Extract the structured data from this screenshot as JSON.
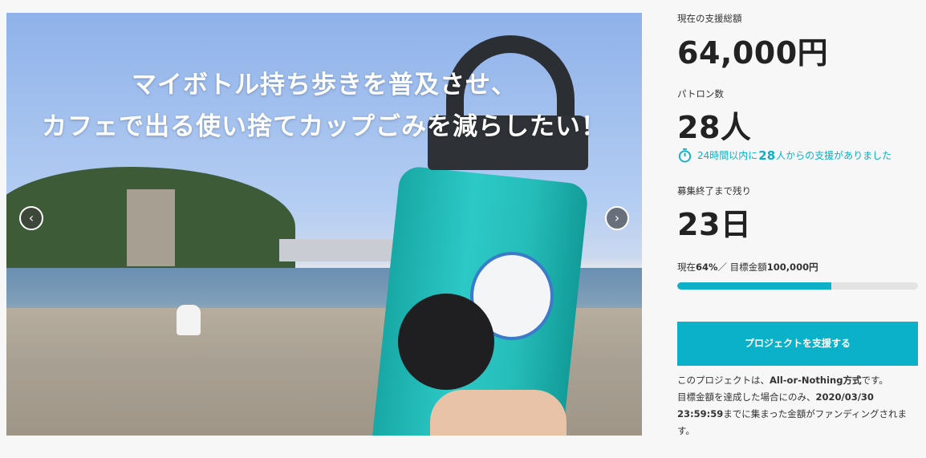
{
  "hero": {
    "headline_line1": "マイボトル持ち歩きを普及させ、",
    "headline_line2": "カフェで出る使い捨てカップごみを減らしたい！",
    "prev_arrow": "‹",
    "next_arrow": "›"
  },
  "stats": {
    "funding_label": "現在の支援総額",
    "funding_amount": "64,000円",
    "patron_label": "パトロン数",
    "patron_count": "28人",
    "recent_prefix": "24時間以内に",
    "recent_count": "28",
    "recent_suffix": "人からの支援がありました",
    "remaining_label": "募集終了まで残り",
    "remaining_days": "23日",
    "progress_text_prefix": "現在",
    "progress_percent": "64%",
    "progress_text_mid": "／ 目標金額",
    "goal_amount": "100,000円",
    "progress_fraction": 0.64
  },
  "cta": {
    "label": "プロジェクトを支援する"
  },
  "note": {
    "line1_prefix": "このプロジェクトは、",
    "line1_bold": "All-or-Nothing方式",
    "line1_suffix": "です。",
    "line2": "目標金額を達成した場合にのみ、",
    "deadline_date": "2020/03/30",
    "deadline_time": "23:59:59",
    "line3_suffix": "までに集まった金額がファンディングされま",
    "line4": "す。"
  },
  "colors": {
    "accent": "#0bb1c8",
    "track": "#e3e3e3"
  },
  "icons": {
    "timer": "stopwatch-icon",
    "prev": "chevron-left-icon",
    "next": "chevron-right-icon"
  }
}
